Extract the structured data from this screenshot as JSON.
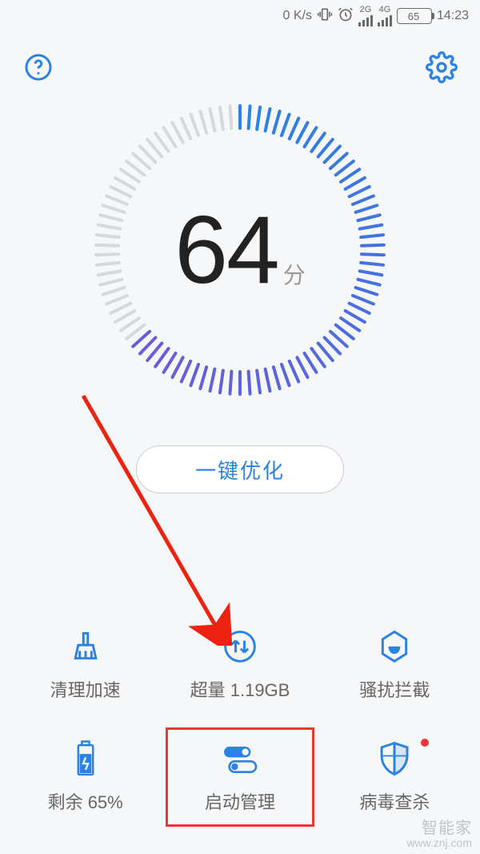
{
  "status_bar": {
    "net_speed": "0 K/s",
    "signal_2g": "2G",
    "signal_4g": "4G",
    "battery_text": "65",
    "time": "14:23"
  },
  "gauge": {
    "score": "64",
    "unit": "分",
    "percent": 64
  },
  "optimize_button": "一键优化",
  "grid": {
    "clean": "清理加速",
    "data": "超量 1.19GB",
    "block": "骚扰拦截",
    "battery": "剩余 65%",
    "startup": "启动管理",
    "virus": "病毒查杀"
  },
  "watermark": {
    "brand": "智能家",
    "url": "www.znj.com"
  }
}
